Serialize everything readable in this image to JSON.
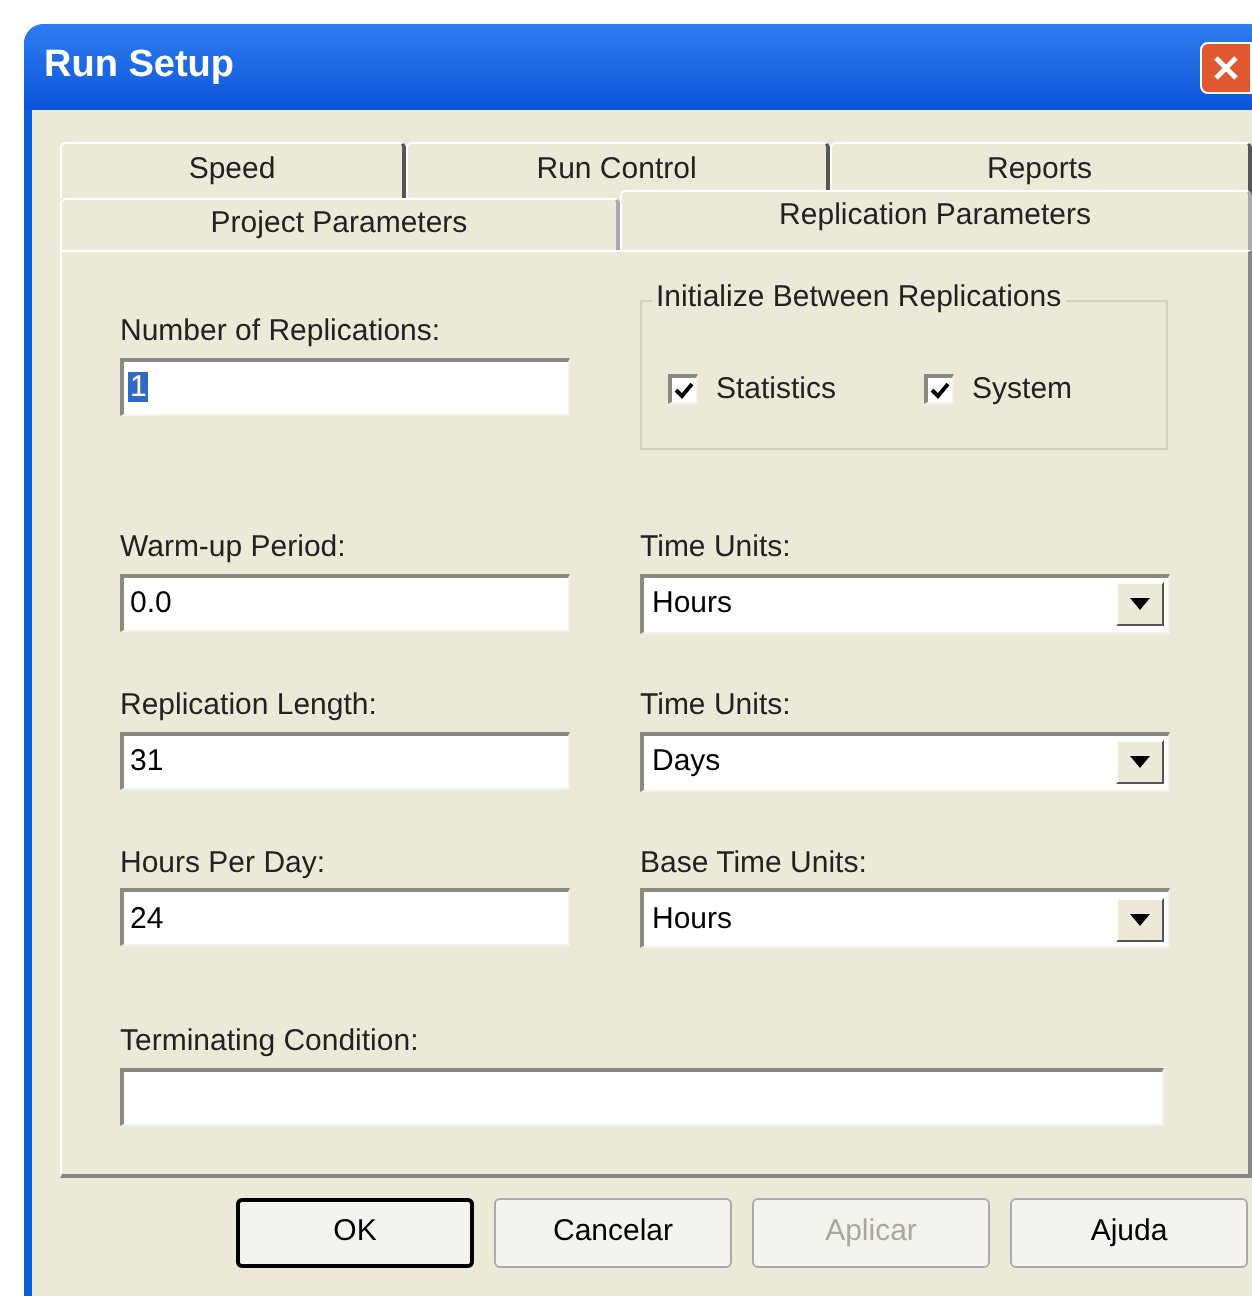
{
  "window": {
    "title": "Run Setup"
  },
  "tabs": {
    "back_row": [
      {
        "label": "Speed",
        "selected": false
      },
      {
        "label": "Run Control",
        "selected": false
      },
      {
        "label": "Reports",
        "selected": false
      }
    ],
    "front_row": [
      {
        "label": "Project Parameters",
        "selected": false
      },
      {
        "label": "Replication Parameters",
        "selected": true
      }
    ]
  },
  "left_fields": [
    {
      "label": "Number of Replications:",
      "value": "1",
      "value_selected": true
    },
    {
      "label": "Warm-up Period:",
      "value": "0.0",
      "value_selected": false
    },
    {
      "label": "Replication Length:",
      "value": "31",
      "value_selected": false
    },
    {
      "label": "Hours Per Day:",
      "value": "24",
      "value_selected": false
    }
  ],
  "initialize_group": {
    "title": "Initialize Between Replications",
    "checkboxes": [
      {
        "label": "Statistics",
        "checked": true
      },
      {
        "label": "System",
        "checked": true
      }
    ]
  },
  "right_dropdowns": [
    {
      "label": "Time Units:",
      "value": "Hours"
    },
    {
      "label": "Time Units:",
      "value": "Days"
    },
    {
      "label": "Base Time Units:",
      "value": "Hours"
    }
  ],
  "terminating_condition": {
    "label": "Terminating Condition:"
  },
  "buttons": [
    {
      "label": "OK",
      "default": true,
      "disabled": false
    },
    {
      "label": "Cancelar",
      "default": false,
      "disabled": false
    },
    {
      "label": "Aplicar",
      "default": false,
      "disabled": true
    },
    {
      "label": "Ajuda",
      "default": false,
      "disabled": false
    }
  ]
}
